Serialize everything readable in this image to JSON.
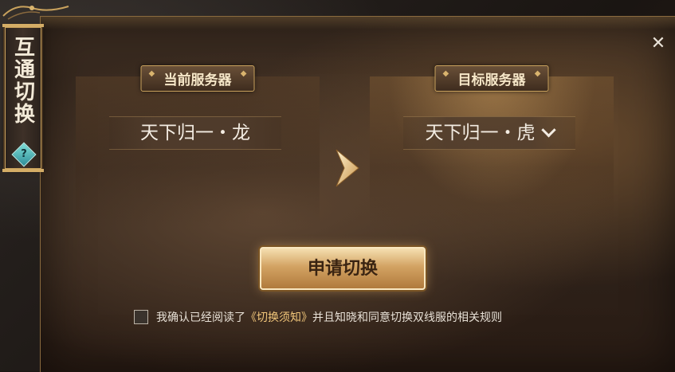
{
  "dialog": {
    "title": "互通切换",
    "close_label": "✕",
    "help_label": "?"
  },
  "current_server": {
    "label": "当前服务器",
    "name": "天下归一・龙"
  },
  "target_server": {
    "label": "目标服务器",
    "name": "天下归一・虎"
  },
  "apply_button": "申请切换",
  "agreement": {
    "prefix": "我确认已经阅读了",
    "link": "《切换须知》",
    "suffix": "并且知晓和同意切换双线服的相关规则",
    "checked": false
  },
  "colors": {
    "accent_gold": "#c9a25d",
    "link_gold": "#f0c57a",
    "button_text": "#3a2412"
  }
}
